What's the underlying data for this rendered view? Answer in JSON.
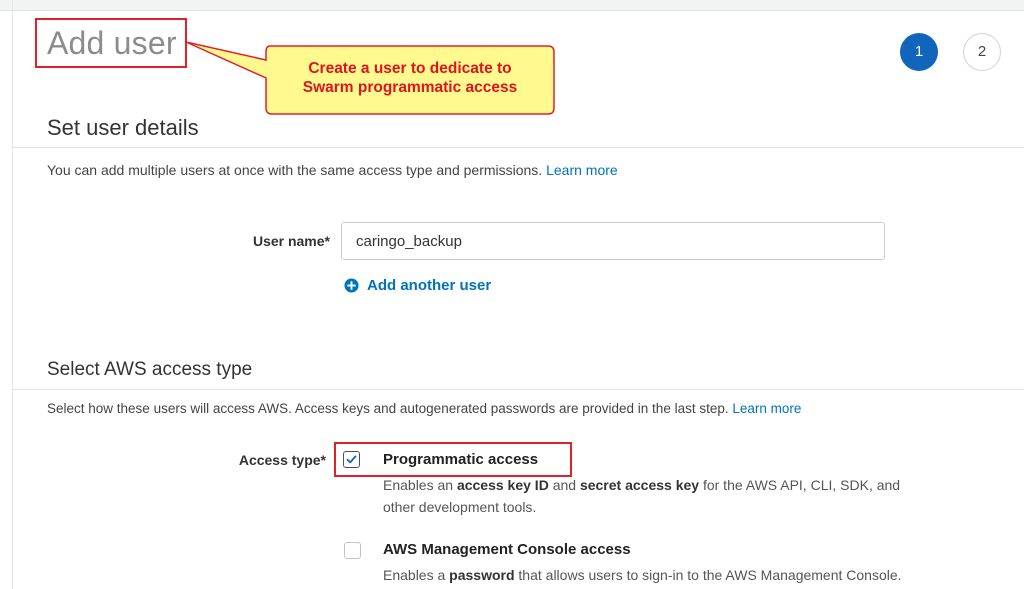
{
  "header": {
    "title": "Add user",
    "steps": [
      "1",
      "2"
    ],
    "active_step": "1"
  },
  "callout": {
    "line1": "Create a user to dedicate to",
    "line2": "Swarm programmatic access"
  },
  "user_details": {
    "heading": "Set user details",
    "description": "You can add multiple users at once with the same access type and permissions.",
    "learn_more": "Learn more",
    "user_name_label": "User name*",
    "user_name_value": "caringo_backup",
    "add_another_user": "Add another user"
  },
  "access": {
    "heading": "Select AWS access type",
    "description": "Select how these users will access AWS. Access keys and autogenerated passwords are provided in the last step.",
    "learn_more": "Learn more",
    "access_type_label": "Access type*",
    "options": [
      {
        "title": "Programmatic access",
        "checked": true,
        "desc_parts": [
          "Enables an ",
          "access key ID",
          " and ",
          "secret access key",
          " for the AWS API, CLI, SDK, and",
          "other development tools."
        ]
      },
      {
        "title": "AWS Management Console access",
        "checked": false,
        "desc_parts": [
          "Enables a ",
          "password",
          " that allows users to sign-in to the AWS Management Console."
        ]
      }
    ]
  },
  "colors": {
    "primary_blue": "#1166bb",
    "link_blue": "#0073bb",
    "highlight_red": "#e0202b",
    "callout_fill": "#fff98f",
    "callout_text": "#e0141e"
  }
}
